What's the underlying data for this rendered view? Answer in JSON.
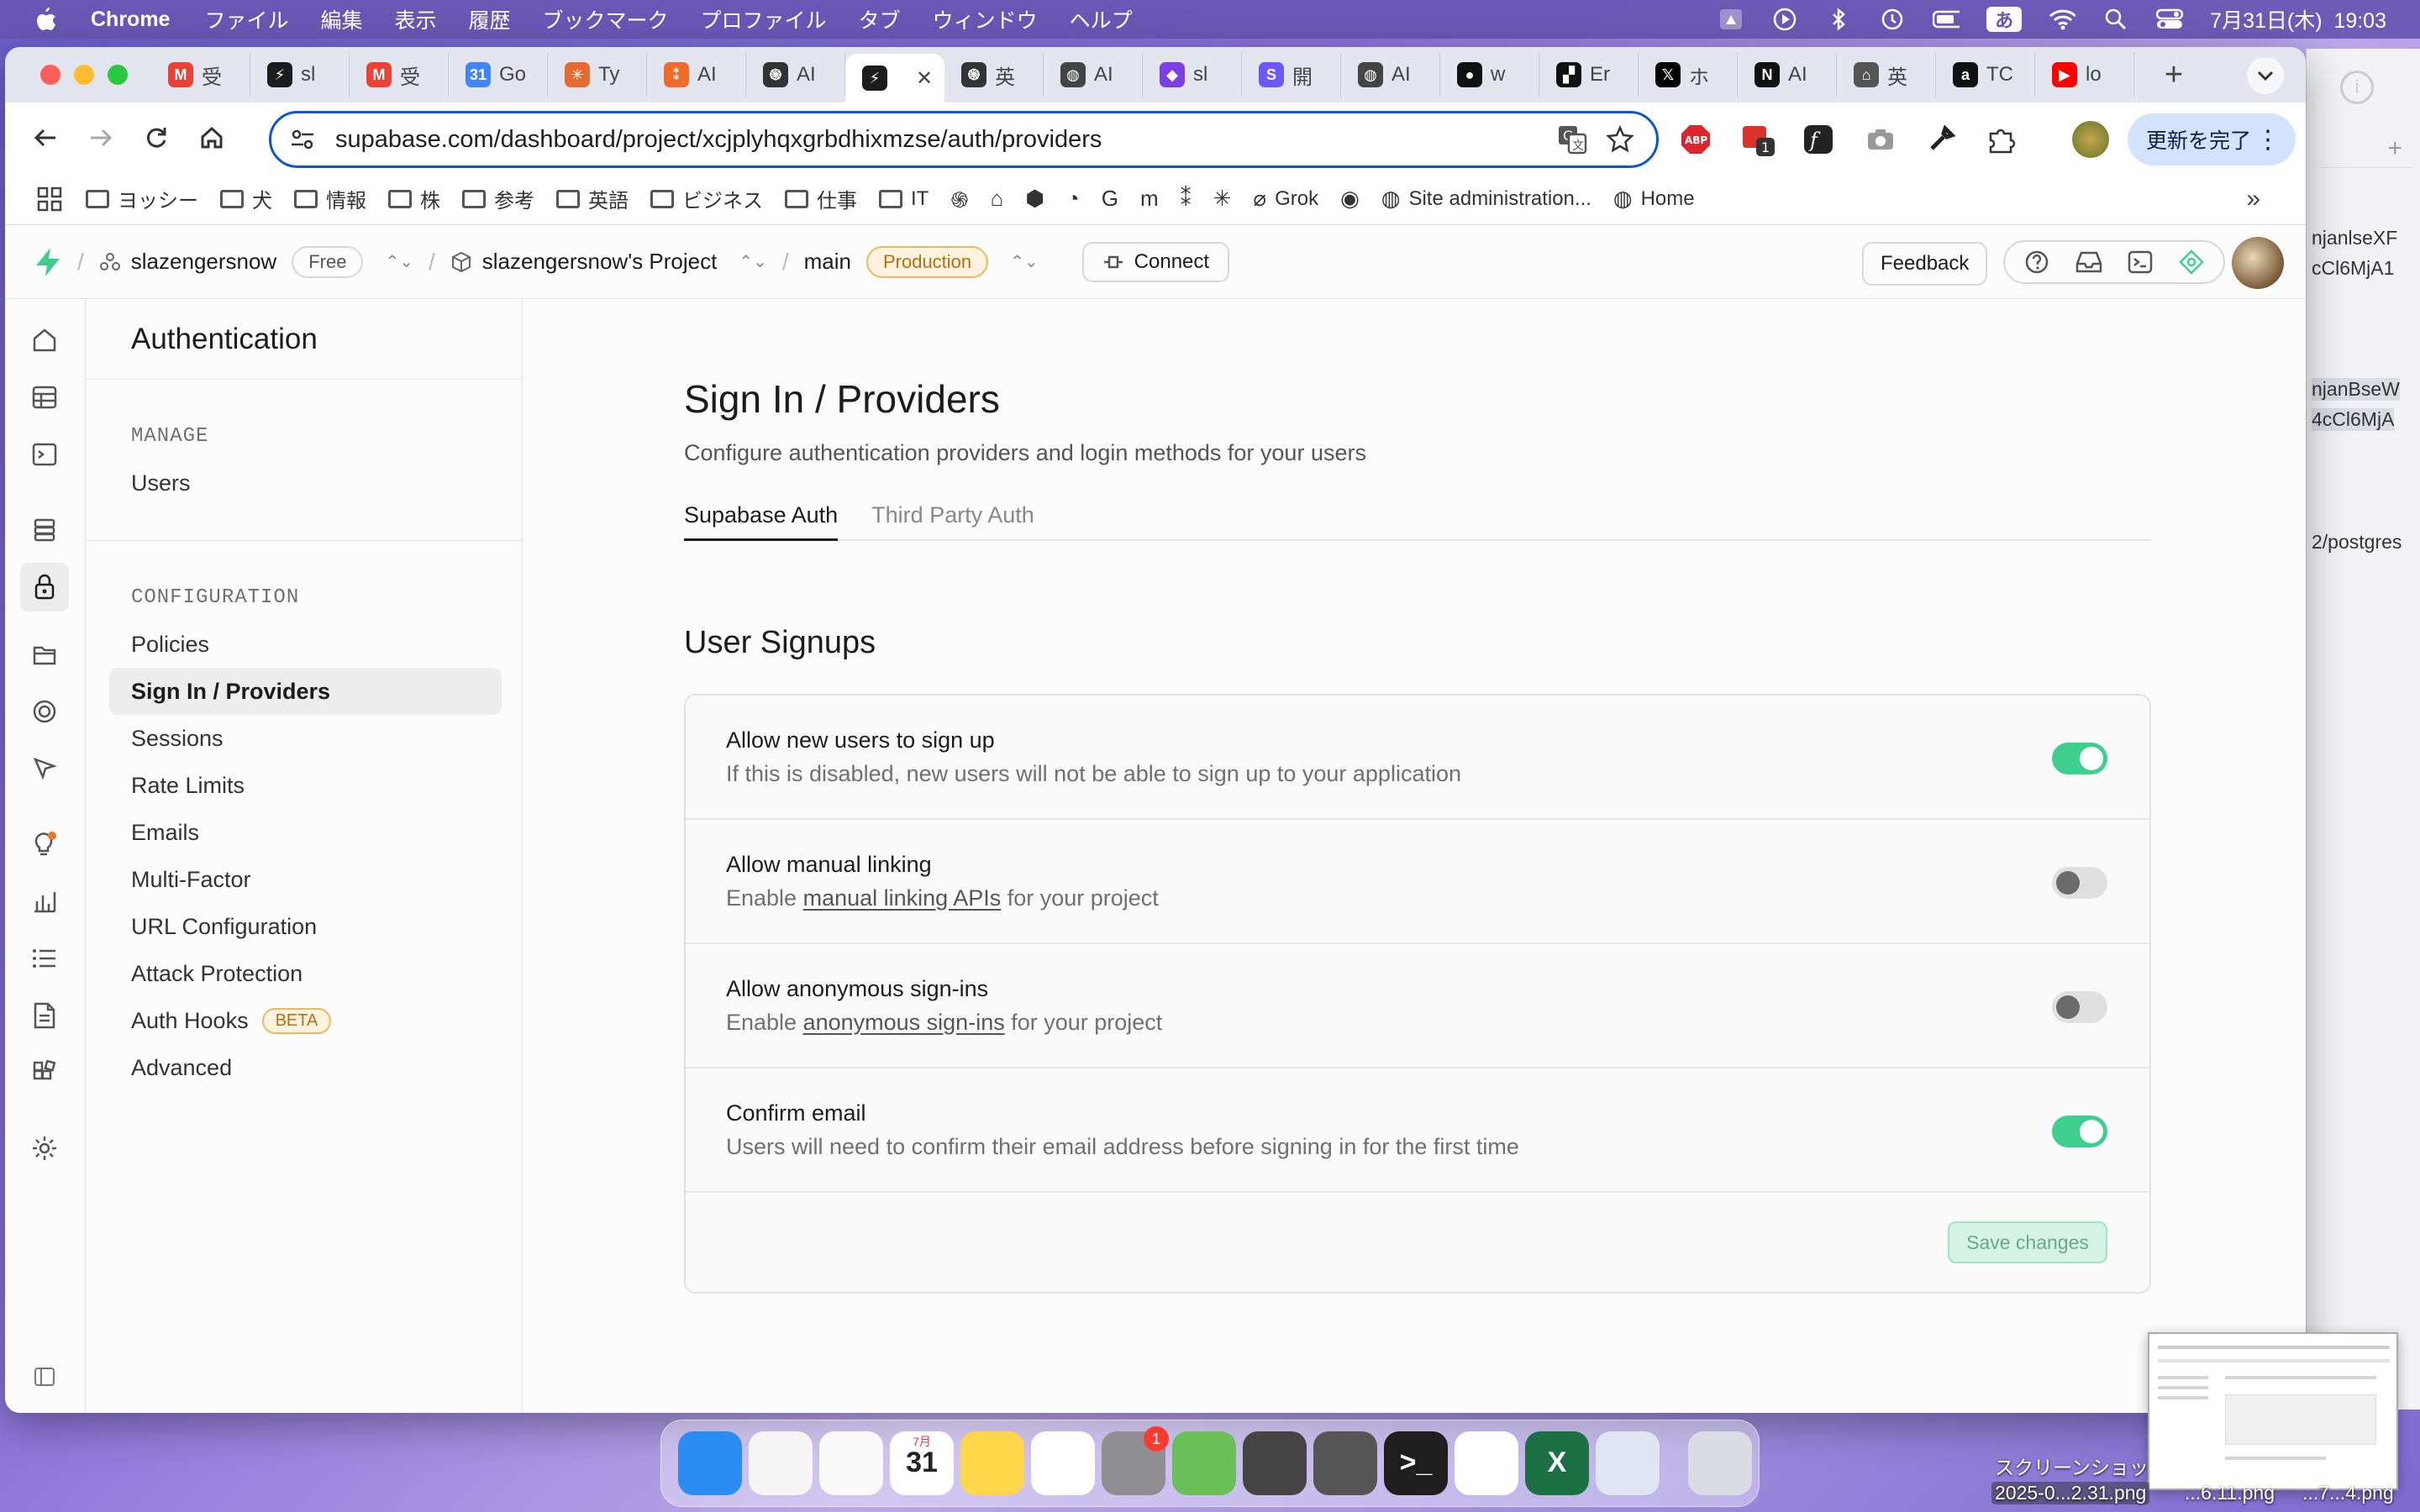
{
  "menubar": {
    "app": "Chrome",
    "items": [
      "ファイル",
      "編集",
      "表示",
      "履歴",
      "ブックマーク",
      "プロファイル",
      "タブ",
      "ウィンドウ",
      "ヘルプ"
    ],
    "ime": "あ",
    "clock": "7月31日(木)  19:03"
  },
  "tabs": [
    {
      "label": "受",
      "color": "#ea4335",
      "glyph": "M"
    },
    {
      "label": "sl",
      "color": "#1c1c1c",
      "glyph": "⚡"
    },
    {
      "label": "受",
      "color": "#ea4335",
      "glyph": "M"
    },
    {
      "label": "Go",
      "color": "#4285f4",
      "glyph": "31"
    },
    {
      "label": "Ty",
      "color": "#e86a33",
      "glyph": "✳"
    },
    {
      "label": "AI",
      "color": "#f06a2a",
      "glyph": "⁑"
    },
    {
      "label": "AI",
      "color": "#333333",
      "glyph": "֍"
    },
    {
      "label": "",
      "color": "#1c1c1c",
      "glyph": "⚡",
      "active": true
    },
    {
      "label": "英",
      "color": "#333333",
      "glyph": "֍"
    },
    {
      "label": "AI",
      "color": "#444444",
      "glyph": "◍"
    },
    {
      "label": "sl",
      "color": "#7b3fe4",
      "glyph": "◆"
    },
    {
      "label": "開",
      "color": "#6a5af9",
      "glyph": "S"
    },
    {
      "label": "AI",
      "color": "#444444",
      "glyph": "◍"
    },
    {
      "label": "w",
      "color": "#111111",
      "glyph": "●"
    },
    {
      "label": "Er",
      "color": "#111111",
      "glyph": "▞"
    },
    {
      "label": "ホ",
      "color": "#000000",
      "glyph": "𝕏"
    },
    {
      "label": "AI",
      "color": "#111111",
      "glyph": "N"
    },
    {
      "label": "英",
      "color": "#555555",
      "glyph": "⌂"
    },
    {
      "label": "TC",
      "color": "#111111",
      "glyph": "a"
    },
    {
      "label": "lo",
      "color": "#ff0000",
      "glyph": "▶"
    }
  ],
  "toolbar": {
    "url": "supabase.com/dashboard/project/xcjplyhqxgrbdhixmzse/auth/providers",
    "ext_badge": "1",
    "update_label": "更新を完了"
  },
  "bookmarks": [
    {
      "label": "ヨッシー",
      "type": "folder"
    },
    {
      "label": "犬",
      "type": "folder"
    },
    {
      "label": "情報",
      "type": "folder"
    },
    {
      "label": "株",
      "type": "folder"
    },
    {
      "label": "参考",
      "type": "folder"
    },
    {
      "label": "英語",
      "type": "folder"
    },
    {
      "label": "ビジネス",
      "type": "folder"
    },
    {
      "label": "仕事",
      "type": "folder"
    },
    {
      "label": "IT",
      "type": "folder"
    },
    {
      "label": "",
      "type": "icon",
      "glyph": "֍"
    },
    {
      "label": "",
      "type": "icon",
      "glyph": "⌂"
    },
    {
      "label": "",
      "type": "icon",
      "glyph": "⬢"
    },
    {
      "label": "",
      "type": "icon",
      "glyph": "◔"
    },
    {
      "label": "",
      "type": "icon",
      "glyph": "G"
    },
    {
      "label": "",
      "type": "icon",
      "glyph": "m"
    },
    {
      "label": "",
      "type": "icon",
      "glyph": "⁑"
    },
    {
      "label": "",
      "type": "icon",
      "glyph": "✳"
    },
    {
      "label": "Grok",
      "type": "icon",
      "glyph": "⌀"
    },
    {
      "label": "",
      "type": "icon",
      "glyph": "◉"
    },
    {
      "label": "Site administration...",
      "type": "icon",
      "glyph": "◍"
    },
    {
      "label": "Home",
      "type": "icon",
      "glyph": "◍"
    }
  ],
  "supabase": {
    "org": "slazengersnow",
    "plan": "Free",
    "project": "slazengersnow's Project",
    "branch": "main",
    "env": "Production",
    "connect": "Connect",
    "feedback": "Feedback"
  },
  "menu": {
    "title": "Authentication",
    "manage_label": "MANAGE",
    "users": "Users",
    "config_label": "CONFIGURATION",
    "items": [
      "Policies",
      "Sign In / Providers",
      "Sessions",
      "Rate Limits",
      "Emails",
      "Multi-Factor",
      "URL Configuration",
      "Attack Protection",
      "Auth Hooks",
      "Advanced"
    ],
    "beta": "BETA"
  },
  "page": {
    "title": "Sign In / Providers",
    "subtitle": "Configure authentication providers and login methods for your users",
    "tabs": [
      "Supabase Auth",
      "Third Party Auth"
    ],
    "section": "User Signups",
    "rows": [
      {
        "label": "Allow new users to sign up",
        "desc_pre": "If this is disabled, new users will not be able to sign up to your application",
        "link": "",
        "desc_post": "",
        "on": true
      },
      {
        "label": "Allow manual linking",
        "desc_pre": "Enable ",
        "link": "manual linking APIs",
        "desc_post": " for your project",
        "on": false
      },
      {
        "label": "Allow anonymous sign-ins",
        "desc_pre": "Enable ",
        "link": "anonymous sign-ins",
        "desc_post": " for your project",
        "on": false
      },
      {
        "label": "Confirm email",
        "desc_pre": "Users will need to confirm their email address before signing in for the first time",
        "link": "",
        "desc_post": "",
        "on": true
      }
    ],
    "save": "Save changes"
  },
  "sidewin": [
    "njanlseXF",
    "cCl6MjA1",
    "njanBseW",
    "4cCl6MjA",
    "2/postgres"
  ],
  "desktop": {
    "file1": "スクリーンショッ",
    "file2": "2025-0...2.31.png",
    "file3": "...6.11.png",
    "file4": "...7...4.png"
  },
  "dock": [
    {
      "name": "finder",
      "color": "#2b8cf2"
    },
    {
      "name": "chrome",
      "color": "#f5f5f5"
    },
    {
      "name": "photos",
      "color": "#fafafa"
    },
    {
      "name": "calendar",
      "color": "#ffffff",
      "text": "31",
      "sub": "7月"
    },
    {
      "name": "notes",
      "color": "#ffd54a"
    },
    {
      "name": "freeform",
      "color": "#ffffff"
    },
    {
      "name": "system-settings",
      "color": "#8e8e93",
      "badge": "1"
    },
    {
      "name": "maps-app",
      "color": "#6bbf59"
    },
    {
      "name": "calculator",
      "color": "#444444"
    },
    {
      "name": "lens-app",
      "color": "#555555"
    },
    {
      "name": "terminal",
      "color": "#1e1e1e",
      "text": ">_"
    },
    {
      "name": "vscode",
      "color": "#ffffff"
    },
    {
      "name": "excel",
      "color": "#1d7044",
      "text": "X"
    },
    {
      "name": "iphone-mirroring",
      "color": "#dfe6f2"
    },
    {
      "name": "trash",
      "color": "#d9dde3"
    }
  ]
}
